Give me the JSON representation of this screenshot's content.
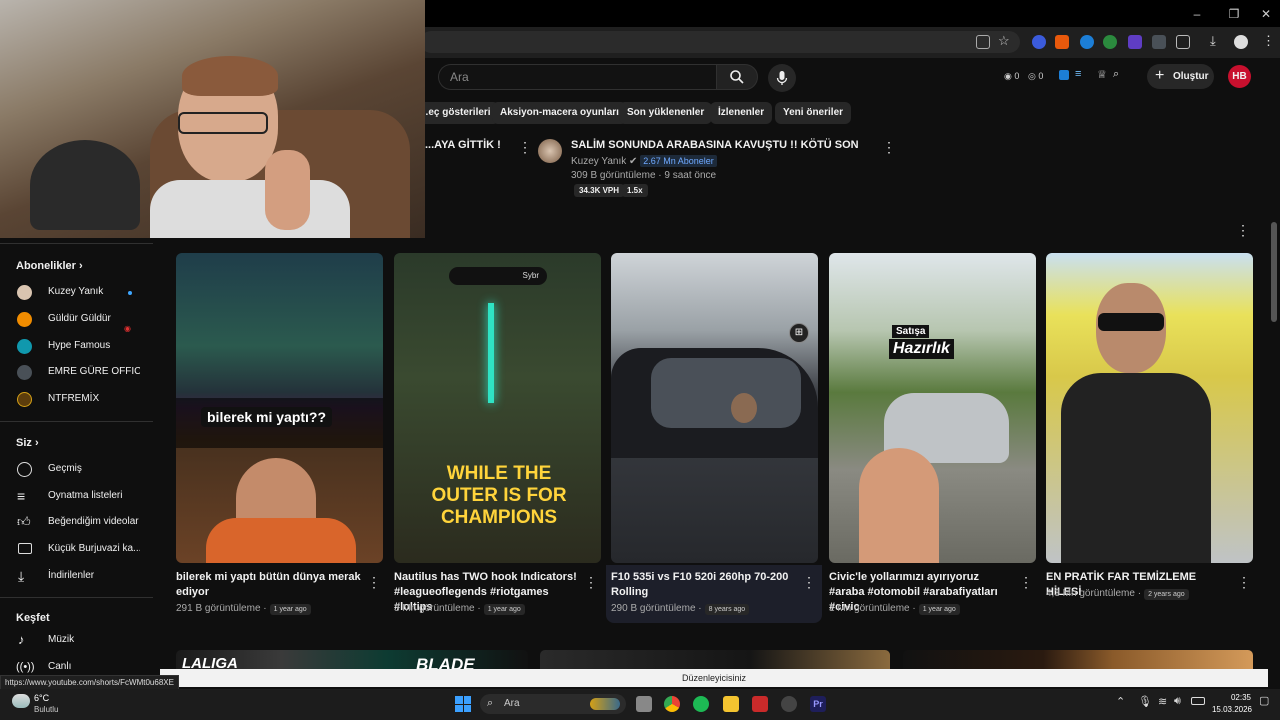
{
  "browser": {
    "window_controls": [
      "–",
      "❐",
      "✕"
    ],
    "toolbar_icons": [
      "install-icon",
      "star-icon",
      "extension-icon",
      "download-icon",
      "profile-icon",
      "menu-icon"
    ]
  },
  "youtube_header": {
    "search_placeholder": "Ara",
    "stats": [
      "0",
      "0"
    ],
    "create_label": "Oluştur",
    "avatar_initials": "HB"
  },
  "chips": [
    "...eç gösterileri",
    "Aksiyon-macera oyunları",
    "Son yüklenenler",
    "İzlenenler",
    "Yeni öneriler"
  ],
  "top_videos": [
    {
      "title": "...AYA GİTTİK !"
    },
    {
      "title": "SALİM SONUNDA ARABASINA KAVUŞTU !! KÖTÜ SON",
      "channel": "Kuzey Yanık",
      "subscribers": "2.67 Mn Aboneler",
      "views_time": "309 B görüntüleme · 9 saat önce",
      "vph": "34.3K VPH",
      "multiplier": "1.5x"
    }
  ],
  "sidebar": {
    "subscriptions_header": "Abonelikler",
    "subscriptions": [
      {
        "label": "Kuzey Yanık"
      },
      {
        "label": "Güldür Güldür"
      },
      {
        "label": "Hype Famous"
      },
      {
        "label": "EMRE GÜRE OFFICI..."
      },
      {
        "label": "NTFREMİX"
      }
    ],
    "you_header": "Siz",
    "you_items": [
      {
        "label": "Geçmiş"
      },
      {
        "label": "Oynatma listeleri"
      },
      {
        "label": "Beğendiğim videolar"
      },
      {
        "label": "Küçük Burjuvazi ka..."
      },
      {
        "label": "İndirilenler"
      }
    ],
    "explore_header": "Keşfet",
    "explore_items": [
      {
        "label": "Müzik"
      },
      {
        "label": "Canlı"
      }
    ]
  },
  "shorts": [
    {
      "title": "bilerek mi yaptı bütün dünya merak ediyor",
      "views": "291 B görüntüleme ·",
      "age": "1 year ago",
      "overlay": "bilerek mi yaptı??"
    },
    {
      "title": "Nautilus has TWO hook Indicators! #leagueoflegends #riotgames #loltips",
      "views": "3 Mn görüntüleme ·",
      "age": "1 year ago",
      "overlay": "WHILE THE OUTER IS FOR CHAMPIONS",
      "top_tag": "Sybr"
    },
    {
      "title": "F10 535i vs F10 520i 260hp 70-200 Rolling",
      "views": "290 B görüntüleme ·",
      "age": "8 years ago"
    },
    {
      "title": "Civic'le yollarımızı ayırıyoruz #araba #otomobil #arabafiyatları #civic",
      "views": "1 Mn görüntüleme ·",
      "age": "1 year ago",
      "overlay_top": "Satışa",
      "overlay": "Hazırlık"
    },
    {
      "title": "EN PRATİK FAR TEMİZLEME HİLESİ",
      "views": "4,3 Mn görüntüleme ·",
      "age": "2 years ago"
    }
  ],
  "bottom_row": {
    "laliga": "LALIGA",
    "blade": "BLADE"
  },
  "status_url": "https://www.youtube.com/shorts/FcWMt0u68XE",
  "editor_bar": "Düzenleyicisiniz",
  "taskbar": {
    "weather_temp": "6°C",
    "weather_desc": "Bulutlu",
    "search_label": "Ara",
    "time": "02:35",
    "date": "15.03.2026"
  },
  "colors": {
    "youtube_red": "#c8102e",
    "background": "#0f0f0f",
    "chip": "#272727"
  }
}
